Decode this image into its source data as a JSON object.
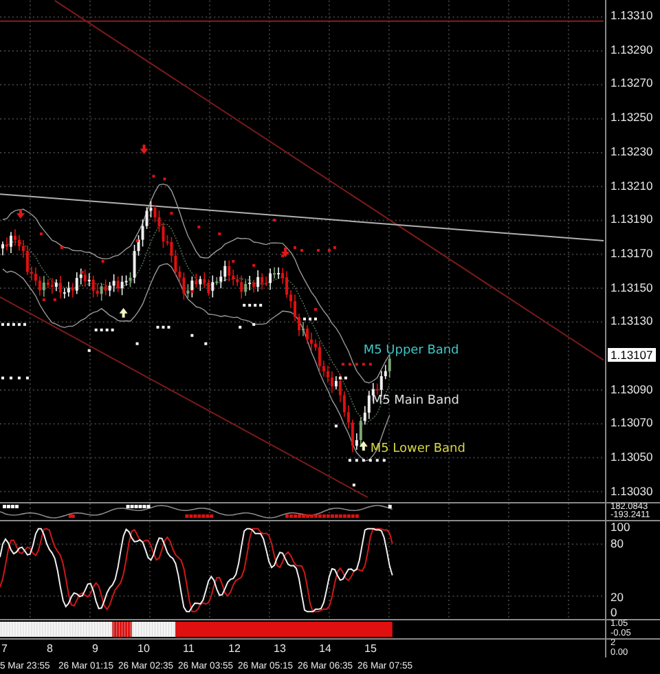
{
  "price_axis": {
    "labels": [
      "1.13310",
      "1.13290",
      "1.13270",
      "1.13250",
      "1.13230",
      "1.13210",
      "1.13190",
      "1.13170",
      "1.13150",
      "1.13130",
      "1.13090",
      "1.13070",
      "1.13050",
      "1.13030"
    ],
    "current_price": "1.13107"
  },
  "band_labels": [
    {
      "text": "M5 Upper Band",
      "color": "#3fc8c8"
    },
    {
      "text": "M5 Main Band",
      "color": "#e0e0e0"
    },
    {
      "text": "M5 Lower Band",
      "color": "#d8d840"
    }
  ],
  "oscillator_panel": {
    "labels": [
      "182.0843",
      "-193.2411"
    ]
  },
  "stochastic_panel": {
    "labels": [
      "100",
      "80",
      "20",
      "0"
    ]
  },
  "signal_panel": {
    "labels": [
      "1.05",
      "-0.05"
    ]
  },
  "bar_index_panel": {
    "numbers": [
      "7",
      "8",
      "9",
      "10",
      "11",
      "12",
      "13",
      "14",
      "15"
    ],
    "labels": [
      "2",
      "0.00"
    ]
  },
  "time_axis": {
    "labels": [
      "5 Mar 23:55",
      "26 Mar 01:15",
      "26 Mar 02:35",
      "26 Mar 03:55",
      "26 Mar 05:15",
      "26 Mar 06:35",
      "26 Mar 07:55"
    ]
  }
}
